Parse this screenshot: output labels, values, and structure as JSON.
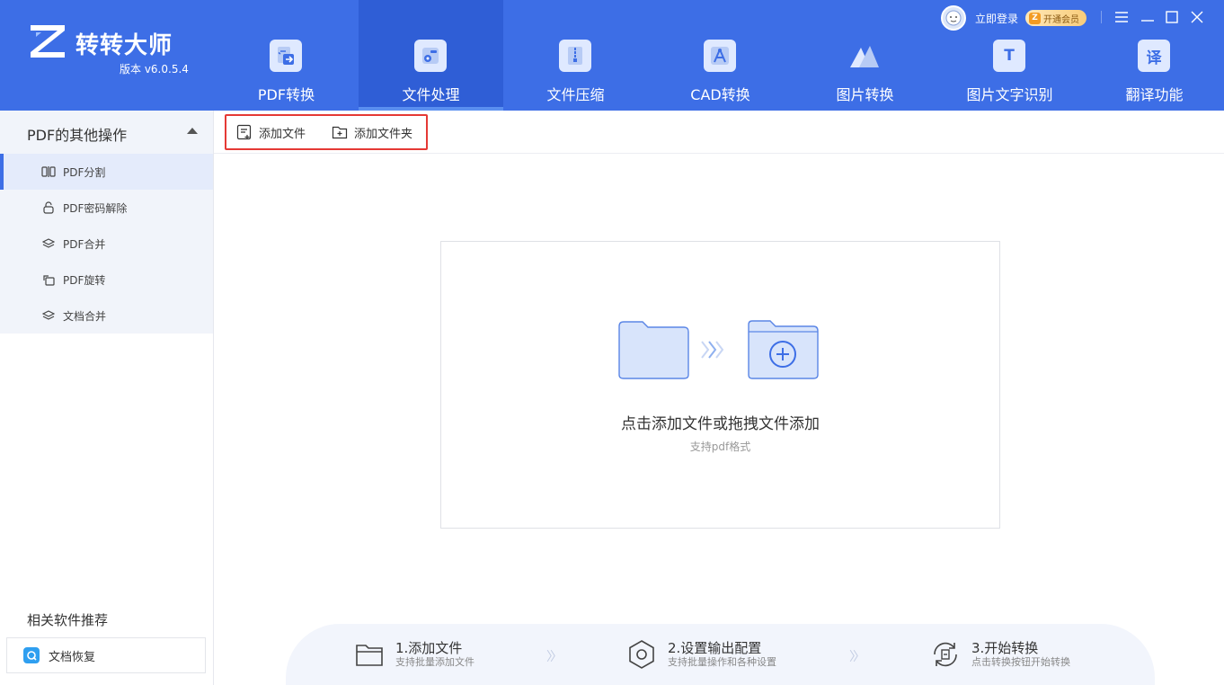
{
  "app": {
    "name": "转转大师",
    "version": "版本 v6.0.5.4",
    "logo_letter": "Z"
  },
  "nav": {
    "tabs": [
      {
        "label": "PDF转换",
        "icon": "pdf-convert-icon",
        "active": false
      },
      {
        "label": "文件处理",
        "icon": "file-process-icon",
        "active": true
      },
      {
        "label": "文件压缩",
        "icon": "zip-icon",
        "active": false
      },
      {
        "label": "CAD转换",
        "icon": "cad-icon",
        "active": false
      },
      {
        "label": "图片转换",
        "icon": "image-icon",
        "active": false
      },
      {
        "label": "图片文字识别",
        "icon": "ocr-text-icon",
        "active": false
      },
      {
        "label": "翻译功能",
        "icon": "translate-icon",
        "active": false
      }
    ],
    "ocr_glyph": "T",
    "translate_glyph": "译"
  },
  "account": {
    "login": "立即登录",
    "vip": "开通会员",
    "vip_badge": "Z"
  },
  "sidebar": {
    "group_title": "PDF的其他操作",
    "items": [
      {
        "label": "PDF分割",
        "icon": "split-icon",
        "active": true
      },
      {
        "label": "PDF密码解除",
        "icon": "unlock-icon",
        "active": false
      },
      {
        "label": "PDF合并",
        "icon": "layers-icon",
        "active": false
      },
      {
        "label": "PDF旋转",
        "icon": "rotate-icon",
        "active": false
      },
      {
        "label": "文档合并",
        "icon": "layers-icon",
        "active": false
      }
    ],
    "related_title": "相关软件推荐",
    "related_item": "文档恢复"
  },
  "toolbar": {
    "add_file": "添加文件",
    "add_folder": "添加文件夹"
  },
  "dropzone": {
    "title": "点击添加文件或拖拽文件添加",
    "subtitle": "支持pdf格式"
  },
  "steps": [
    {
      "title": "1.添加文件",
      "desc": "支持批量添加文件",
      "icon": "folder-icon"
    },
    {
      "title": "2.设置输出配置",
      "desc": "支持批量操作和各种设置",
      "icon": "settings-icon"
    },
    {
      "title": "3.开始转换",
      "desc": "点击转换按钮开始转换",
      "icon": "convert-icon"
    }
  ],
  "colors": {
    "primary": "#3d6ee6",
    "active_tab": "#2f5ed6",
    "highlight": "#e53935"
  }
}
